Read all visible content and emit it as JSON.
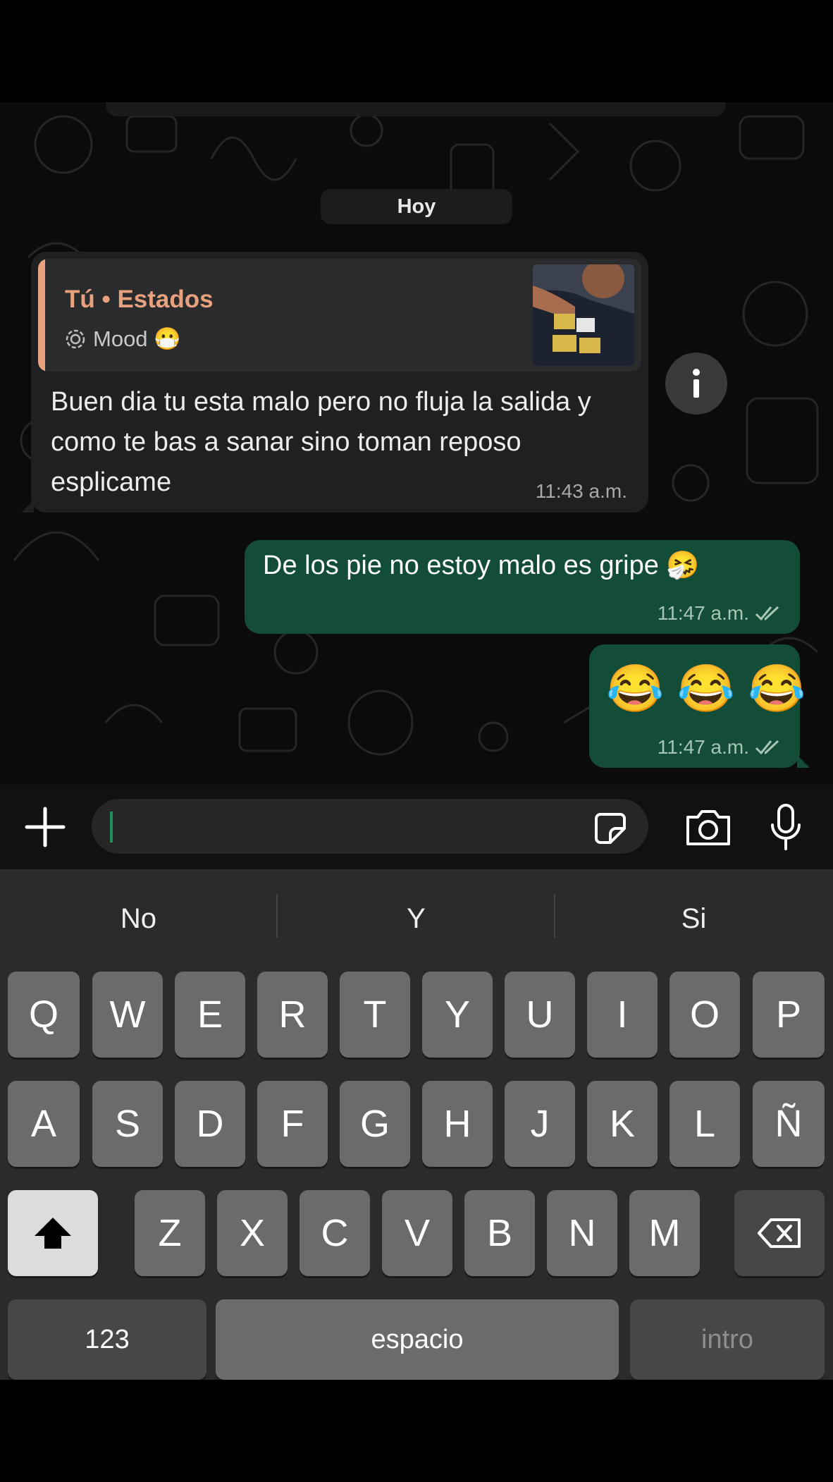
{
  "chat": {
    "date_label": "Hoy",
    "incoming": {
      "quote_title": "Tú • Estados",
      "quote_sub": "Mood 😷",
      "text": "Buen dia tu esta malo  pero no fluja la salida  y como te bas a sanar sino toman reposo  esplicame",
      "time": "11:43 a.m."
    },
    "outgoing": [
      {
        "text": "De los pie no estoy malo es gripe 🤧",
        "time": "11:47 a.m."
      },
      {
        "text": "😂 😂 😂",
        "time": "11:47 a.m."
      }
    ]
  },
  "icons": {
    "info": "info-icon",
    "plus": "plus-icon",
    "sticker": "sticker-icon",
    "camera": "camera-icon",
    "mic": "microphone-icon",
    "read_receipt": "double-check-icon"
  },
  "keyboard": {
    "suggestions": [
      "No",
      "Y",
      "Si"
    ],
    "row1": [
      "Q",
      "W",
      "E",
      "R",
      "T",
      "Y",
      "U",
      "I",
      "O",
      "P"
    ],
    "row2": [
      "A",
      "S",
      "D",
      "F",
      "G",
      "H",
      "J",
      "K",
      "L",
      "Ñ"
    ],
    "row3": [
      "Z",
      "X",
      "C",
      "V",
      "B",
      "N",
      "M"
    ],
    "numbers_label": "123",
    "space_label": "espacio",
    "return_label": "intro"
  },
  "colors": {
    "outgoing_bubble": "#134d37",
    "incoming_bubble": "#1f2021",
    "quote_accent": "#e8a17e"
  }
}
